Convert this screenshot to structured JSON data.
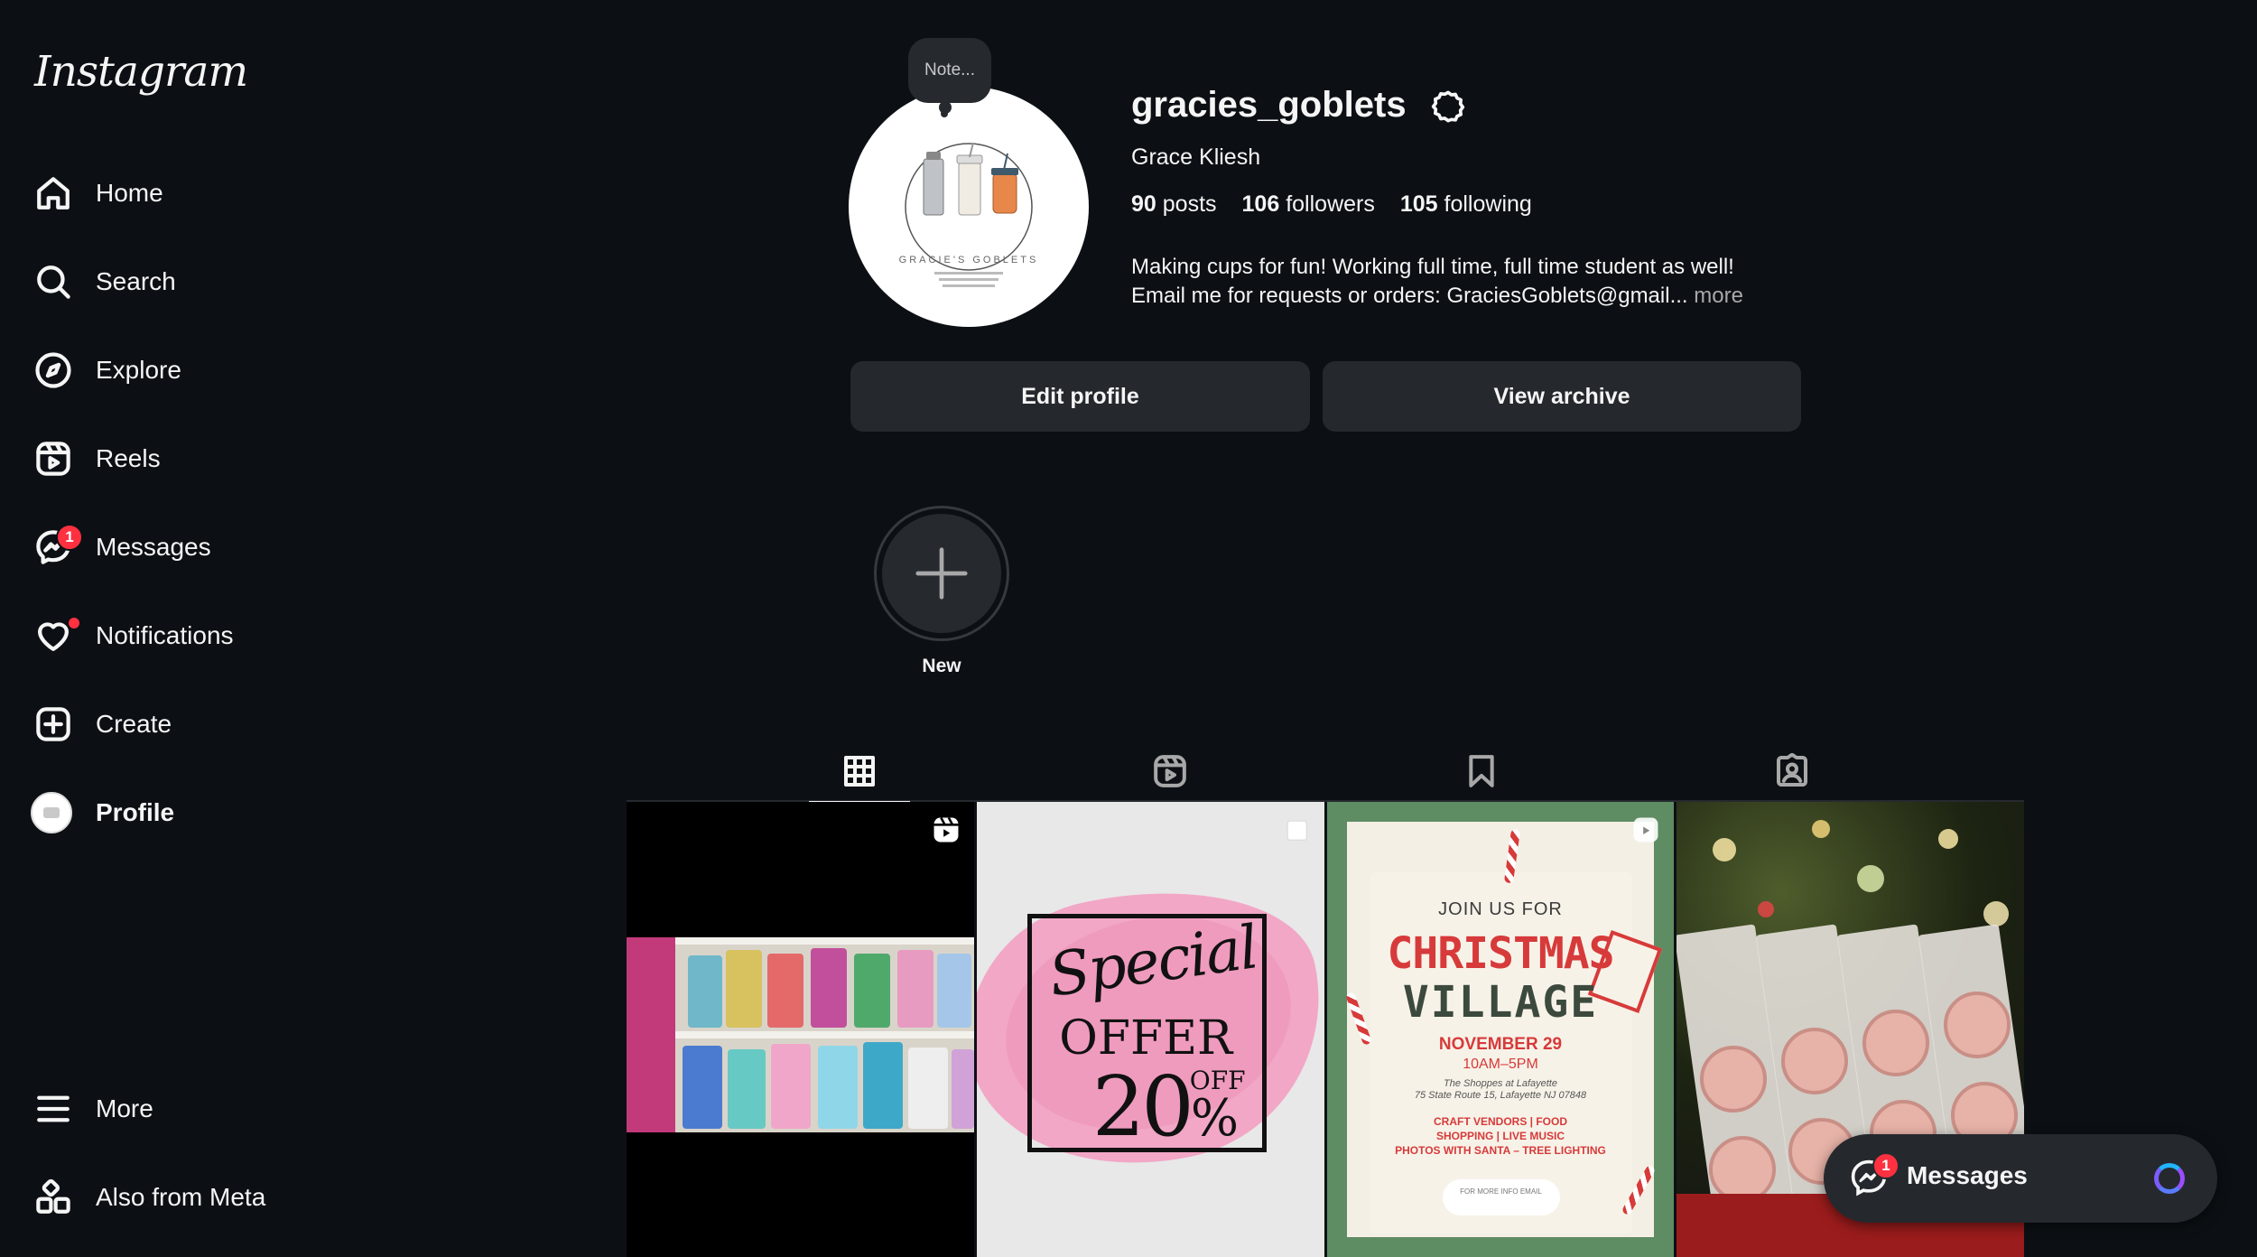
{
  "app": {
    "logo_text": "Instagram"
  },
  "sidebar": {
    "items": [
      {
        "label": "Home",
        "icon": "home-icon"
      },
      {
        "label": "Search",
        "icon": "search-icon"
      },
      {
        "label": "Explore",
        "icon": "compass-icon"
      },
      {
        "label": "Reels",
        "icon": "reels-icon"
      },
      {
        "label": "Messages",
        "icon": "messenger-icon",
        "badge": "1"
      },
      {
        "label": "Notifications",
        "icon": "heart-icon",
        "dot": true
      },
      {
        "label": "Create",
        "icon": "plus-square-icon"
      },
      {
        "label": "Profile",
        "icon": "avatar"
      }
    ],
    "bottom": [
      {
        "label": "More",
        "icon": "hamburger-icon"
      },
      {
        "label": "Also from Meta",
        "icon": "meta-grid-icon"
      }
    ]
  },
  "profile": {
    "note": "Note...",
    "username": "gracies_goblets",
    "full_name": "Grace Kliesh",
    "stats": {
      "posts_count": "90",
      "posts_label": "posts",
      "followers_count": "106",
      "followers_label": "followers",
      "following_count": "105",
      "following_label": "following"
    },
    "bio_line1": "Making cups for fun! Working full time, full time student as well!",
    "bio_line2": "Email me for requests or orders: GraciesGoblets@gmail...",
    "bio_more": "more",
    "edit_profile": "Edit profile",
    "view_archive": "View archive",
    "new_story_label": "New"
  },
  "avatar_logo": {
    "brand": "GRACIE'S GOBLETS"
  },
  "tabs": [
    {
      "name": "posts",
      "icon": "grid-icon",
      "active": true
    },
    {
      "name": "reels",
      "icon": "reels-icon",
      "active": false
    },
    {
      "name": "saved",
      "icon": "bookmark-icon",
      "active": false
    },
    {
      "name": "tagged",
      "icon": "tagged-icon",
      "active": false
    }
  ],
  "posts": {
    "offer": {
      "line1": "Special",
      "line2": "OFFER",
      "pct": "20",
      "pct_sign": "%",
      "off": "OFF"
    },
    "xmas": {
      "join": "JOIN US FOR",
      "title1": "CHRISTMAS",
      "title2": "VILLAGE",
      "date": "NOVEMBER 29",
      "time": "10AM–5PM",
      "venue1": "The Shoppes at Lafayette",
      "venue2": "75 State Route 15, Lafayette NJ 07848",
      "info1": "CRAFT VENDORS | FOOD",
      "info2": "SHOPPING | LIVE MUSIC",
      "info3": "PHOTOS WITH SANTA – TREE LIGHTING",
      "contact": "FOR MORE INFO EMAIL"
    }
  },
  "messages_pill": {
    "label": "Messages",
    "badge": "1"
  },
  "colors": {
    "background": "#0c1014",
    "button": "#25292e",
    "badge": "#ff3040",
    "muted": "#a8a8a8"
  }
}
